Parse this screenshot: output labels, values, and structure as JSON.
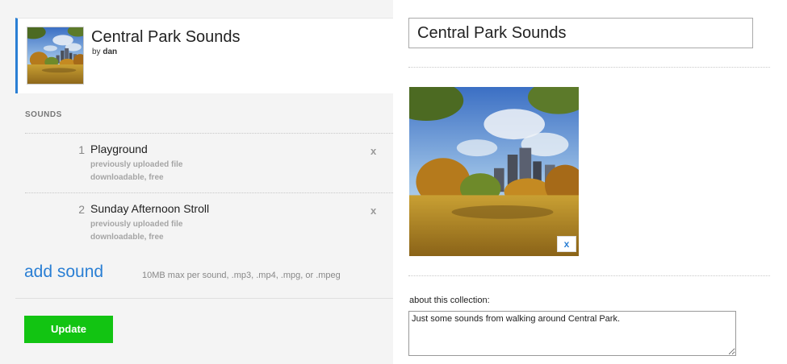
{
  "collection": {
    "title": "Central Park Sounds",
    "by_prefix": "by",
    "author": "dan"
  },
  "sounds_section": {
    "heading": "SOUNDS",
    "items": [
      {
        "number": "1",
        "title": "Playground",
        "status": "previously uploaded file",
        "license": "downloadable, free",
        "remove": "x"
      },
      {
        "number": "2",
        "title": "Sunday Afternoon Stroll",
        "status": "previously uploaded file",
        "license": "downloadable, free",
        "remove": "x"
      }
    ],
    "add_label": "add sound",
    "limits": "10MB max per sound, .mp3, .mp4, .mpg, or .mpeg"
  },
  "update_label": "Update",
  "editor": {
    "title_value": "Central Park Sounds",
    "image_remove": "x",
    "about_label": "about this collection:",
    "about_value": "Just some sounds from walking around Central Park."
  },
  "colors": {
    "accent": "#2a7fd4",
    "update_button": "#12c412"
  },
  "icons": {
    "collection_thumbnail": "central-park-photo",
    "cover_image": "central-park-photo"
  }
}
